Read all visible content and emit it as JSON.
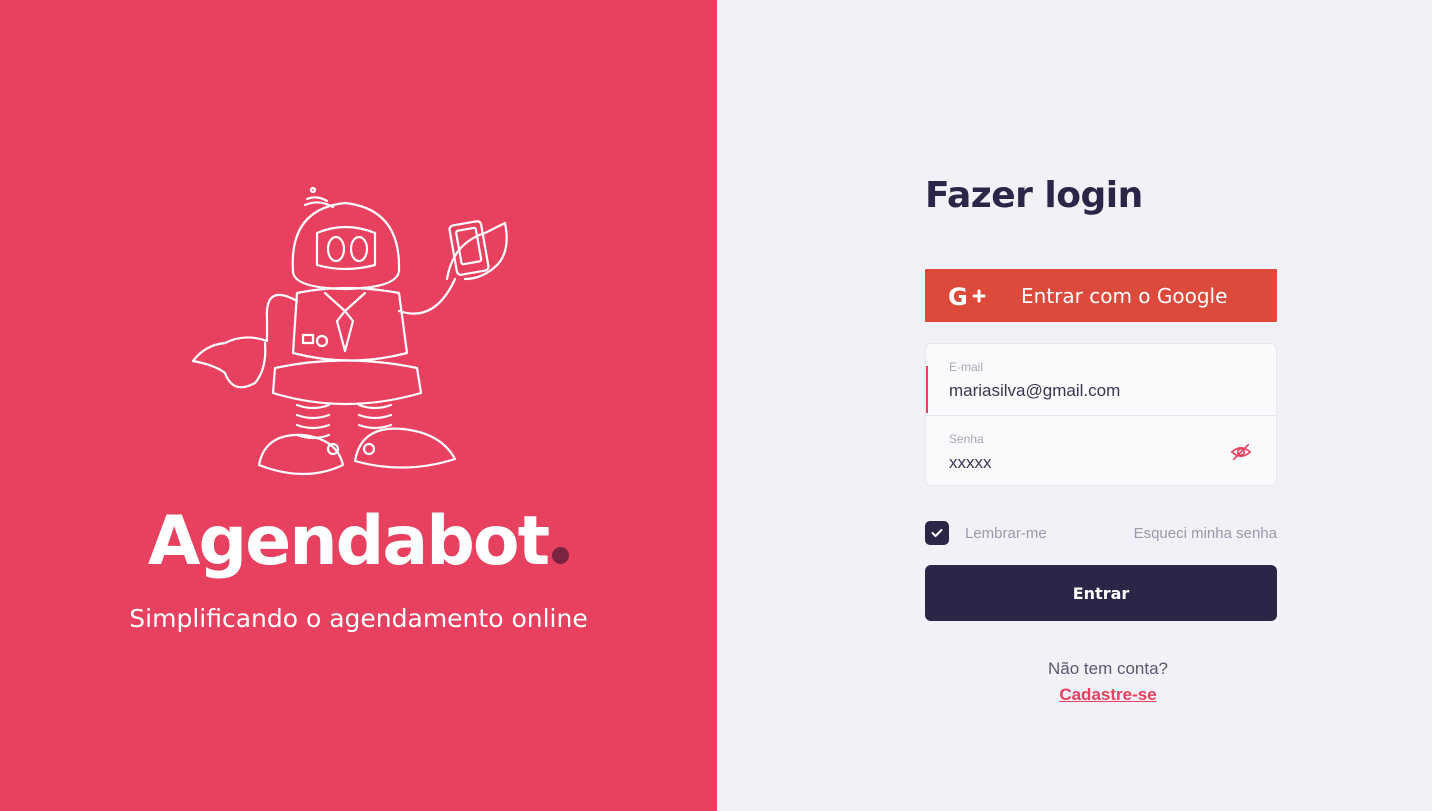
{
  "hero": {
    "brand_name": "Agendabot",
    "tagline": "Simplificando o agendamento online",
    "illustration": "robot-holding-phone-illustration",
    "background_color": "#E8415F",
    "dot_color": "#7A2442"
  },
  "login": {
    "title": "Fazer login",
    "google_button": {
      "icon": "google-plus-icon",
      "label": "Entrar com o Google",
      "color": "#DB4A3B"
    },
    "email": {
      "label": "E-mail",
      "value": "mariasilva@gmail.com"
    },
    "password": {
      "label": "Senha",
      "value": "xxxxx",
      "toggle_icon": "eye-off-icon"
    },
    "remember": {
      "label": "Lembrar-me",
      "checked": true
    },
    "forgot_label": "Esqueci minha senha",
    "submit_label": "Entrar",
    "signup_question": "Não tem conta?",
    "signup_link": "Cadastre-se",
    "primary_color": "#2D2548",
    "accent_color": "#E8415F"
  }
}
